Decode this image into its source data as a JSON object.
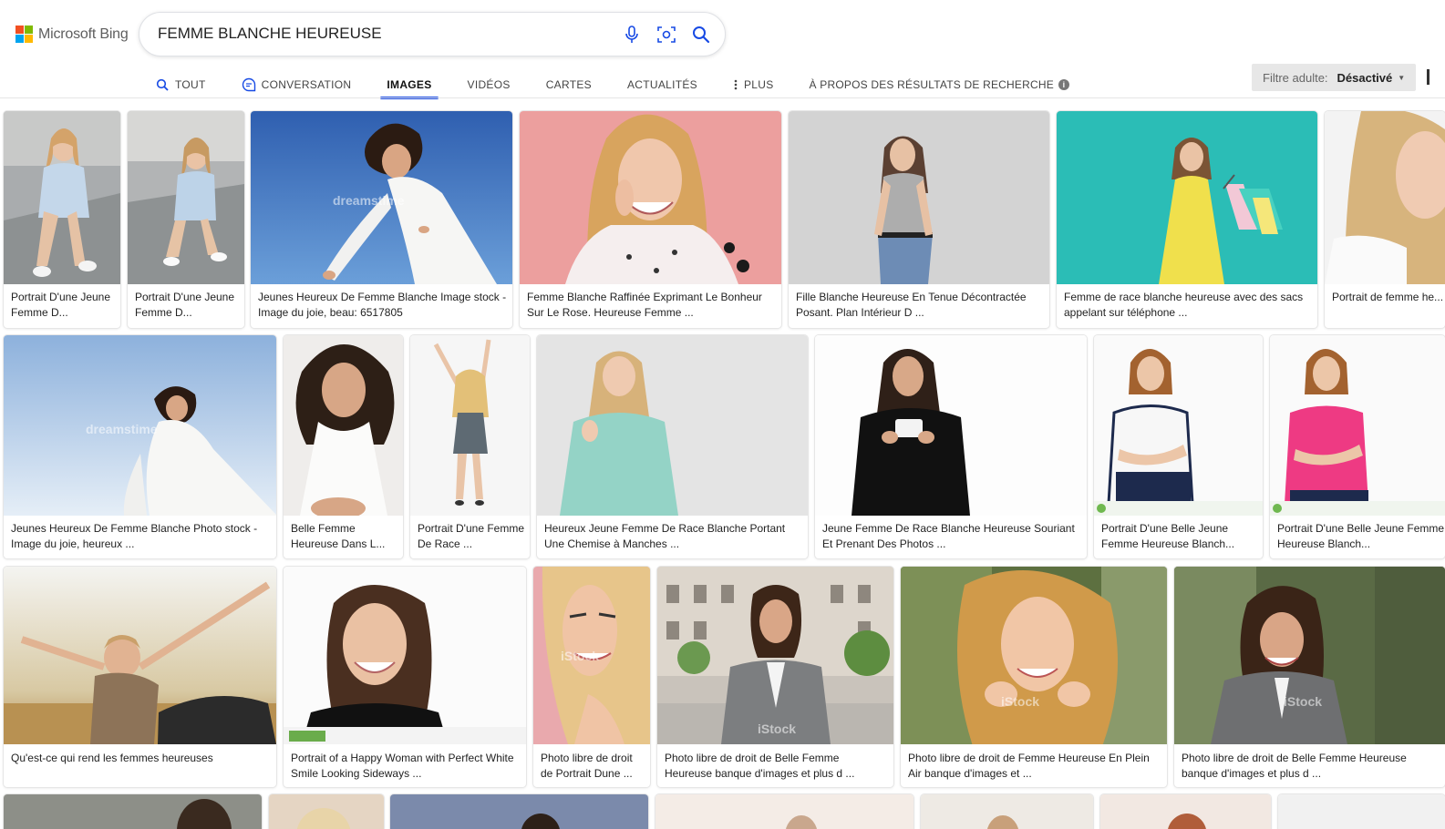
{
  "brand": {
    "name": "Microsoft Bing",
    "colors": [
      "#f25022",
      "#7fba00",
      "#00a4ef",
      "#ffb900"
    ]
  },
  "search": {
    "query": "FEMME BLANCHE HEUREUSE",
    "icons": [
      "microphone-icon",
      "visual-search-icon",
      "search-icon"
    ]
  },
  "tabs": [
    {
      "label": "TOUT",
      "icon": "search-icon"
    },
    {
      "label": "CONVERSATION",
      "icon": "chat-icon"
    },
    {
      "label": "IMAGES",
      "active": true
    },
    {
      "label": "VIDÉOS"
    },
    {
      "label": "CARTES"
    },
    {
      "label": "ACTUALITÉS"
    },
    {
      "label": "PLUS",
      "icon": "more-icon"
    }
  ],
  "about": "À PROPOS DES RÉSULTATS DE RECHERCHE",
  "filter": {
    "label": "Filtre adulte:",
    "value": "Désactivé"
  },
  "accent": "#174ae4",
  "rows": [
    [
      {
        "caption": "Portrait D'une Jeune Femme D..."
      },
      {
        "caption": "Portrait D'une Jeune Femme D..."
      },
      {
        "caption": "Jeunes Heureux De Femme Blanche Image stock - Image du joie, beau: 6517805"
      },
      {
        "caption": "Femme Blanche Raffinée Exprimant Le Bonheur Sur Le Rose. Heureuse Femme ..."
      },
      {
        "caption": "Fille Blanche Heureuse En Tenue Décontractée Posant. Plan Intérieur D ..."
      },
      {
        "caption": "Femme de race blanche heureuse avec des sacs appelant sur téléphone ..."
      },
      {
        "caption": "Portrait de femme he... Télécharger des Pho..."
      }
    ],
    [
      {
        "caption": "Jeunes Heureux De Femme Blanche Photo stock - Image du joie, heureux ..."
      },
      {
        "caption": "Belle Femme Heureuse Dans L..."
      },
      {
        "caption": "Portrait D'une Femme De Race ..."
      },
      {
        "caption": "Heureux Jeune Femme De Race Blanche Portant Une Chemise à Manches ..."
      },
      {
        "caption": "Jeune Femme De Race Blanche Heureuse Souriant Et Prenant Des Photos ..."
      },
      {
        "caption": "Portrait D'une Belle Jeune Femme Heureuse Blanch..."
      },
      {
        "caption": "Portrait D'une Belle Jeune Femme Heureuse Blanch..."
      }
    ],
    [
      {
        "caption": "Qu'est-ce qui rend les femmes heureuses"
      },
      {
        "caption": "Portrait of a Happy Woman with Perfect White Smile Looking Sideways ..."
      },
      {
        "caption": "Photo libre de droit de Portrait Dune ..."
      },
      {
        "caption": "Photo libre de droit de Belle Femme Heureuse banque d'images et plus d ..."
      },
      {
        "caption": "Photo libre de droit de Femme Heureuse En Plein Air banque d'images et ..."
      },
      {
        "caption": "Photo libre de droit de Belle Femme Heureuse banque d'images et plus d ..."
      }
    ]
  ]
}
